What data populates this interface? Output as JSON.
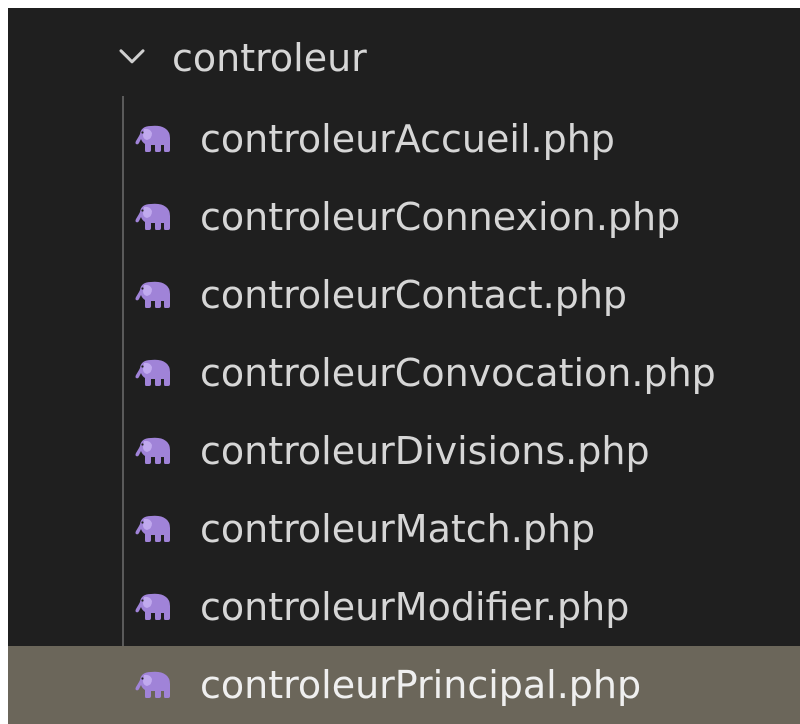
{
  "explorer": {
    "folder": {
      "name": "controleur",
      "expanded": true,
      "icon": "chevron-down-icon"
    },
    "files": [
      {
        "name": "controleurAccueil.php",
        "icon": "php-elephant-icon",
        "selected": false
      },
      {
        "name": "controleurConnexion.php",
        "icon": "php-elephant-icon",
        "selected": false
      },
      {
        "name": "controleurContact.php",
        "icon": "php-elephant-icon",
        "selected": false
      },
      {
        "name": "controleurConvocation.php",
        "icon": "php-elephant-icon",
        "selected": false
      },
      {
        "name": "controleurDivisions.php",
        "icon": "php-elephant-icon",
        "selected": false
      },
      {
        "name": "controleurMatch.php",
        "icon": "php-elephant-icon",
        "selected": false
      },
      {
        "name": "controleurModifier.php",
        "icon": "php-elephant-icon",
        "selected": false
      },
      {
        "name": "controleurPrincipal.php",
        "icon": "php-elephant-icon",
        "selected": true
      }
    ],
    "colors": {
      "background": "#1f1f1f",
      "text": "#d6d6d6",
      "selected_row": "#6b665a",
      "php_icon": "#a083d8"
    }
  }
}
